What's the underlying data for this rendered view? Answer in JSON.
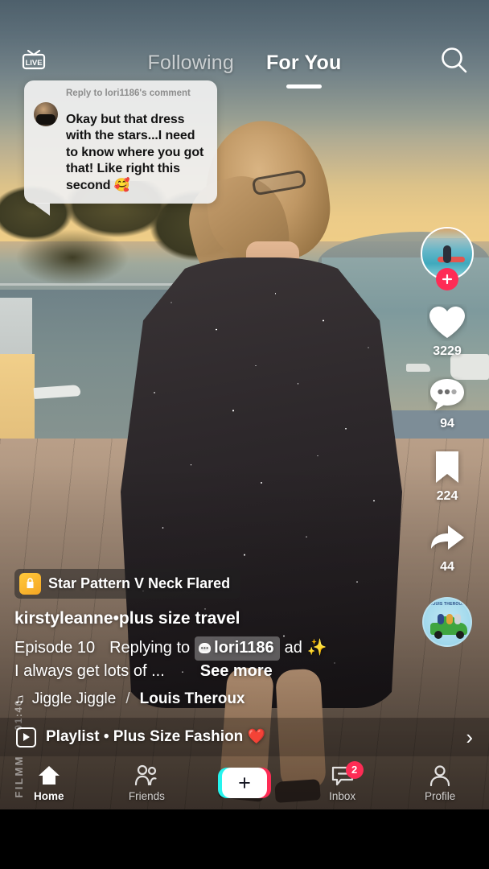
{
  "top_nav": {
    "live_label": "LIVE",
    "live_icon": "tv-live-icon",
    "tabs": [
      {
        "label": "Following",
        "active": false
      },
      {
        "label": "For You",
        "active": true
      }
    ],
    "search_icon": "search-icon"
  },
  "comment_bubble": {
    "reply_to": "Reply to lori1186's comment",
    "text": "Okay but that dress with the stars...I need to know where you got that! Like right this second 🥰",
    "avatar_icon": "commenter-avatar"
  },
  "actions": {
    "avatar_icon": "author-avatar",
    "follow_icon": "plus-icon",
    "like": {
      "icon": "heart-icon",
      "count": "3229"
    },
    "comment": {
      "icon": "comment-bubble-icon",
      "count": "94"
    },
    "bookmark": {
      "icon": "bookmark-icon",
      "count": "224"
    },
    "share": {
      "icon": "share-arrow-icon",
      "count": "44"
    },
    "music_disc": {
      "icon": "album-disc-icon",
      "title": "LOUIS THEROUX"
    }
  },
  "caption": {
    "product_tag": {
      "icon": "shopping-bag-icon",
      "name": "Star Pattern V Neck Flared"
    },
    "username": "kirstyleanne•plus size travel",
    "line1_prefix": "Episode 10",
    "line1_replying": "Replying to",
    "mention": "lori1186",
    "mention_icon": "comment-dots-icon",
    "line1_suffix": "ad ✨",
    "line2": "I always get lots of ...",
    "see_more": "See more",
    "music_icon": "music-note-icon",
    "music_title": "Jiggle Jiggle",
    "music_separator": "/",
    "music_artist": "Louis Theroux"
  },
  "playlist": {
    "icon": "playlist-play-icon",
    "label": "Playlist • Plus Size Fashion",
    "heart": "❤️",
    "chevron": "›"
  },
  "watermark": {
    "brand": "FILMM",
    "timestamp": "01:40"
  },
  "bottom_nav": {
    "items": [
      {
        "label": "Home",
        "icon": "home-icon",
        "active": true
      },
      {
        "label": "Friends",
        "icon": "friends-icon",
        "active": false
      },
      {
        "label": "Inbox",
        "icon": "inbox-icon",
        "active": false,
        "badge": "2"
      },
      {
        "label": "Profile",
        "icon": "profile-icon",
        "active": false
      }
    ],
    "create_icon": "plus-icon"
  },
  "colors": {
    "accent_pink": "#fe2c55",
    "accent_cyan": "#25f4ee",
    "white": "#ffffff",
    "badge_red": "#fe2c55"
  }
}
